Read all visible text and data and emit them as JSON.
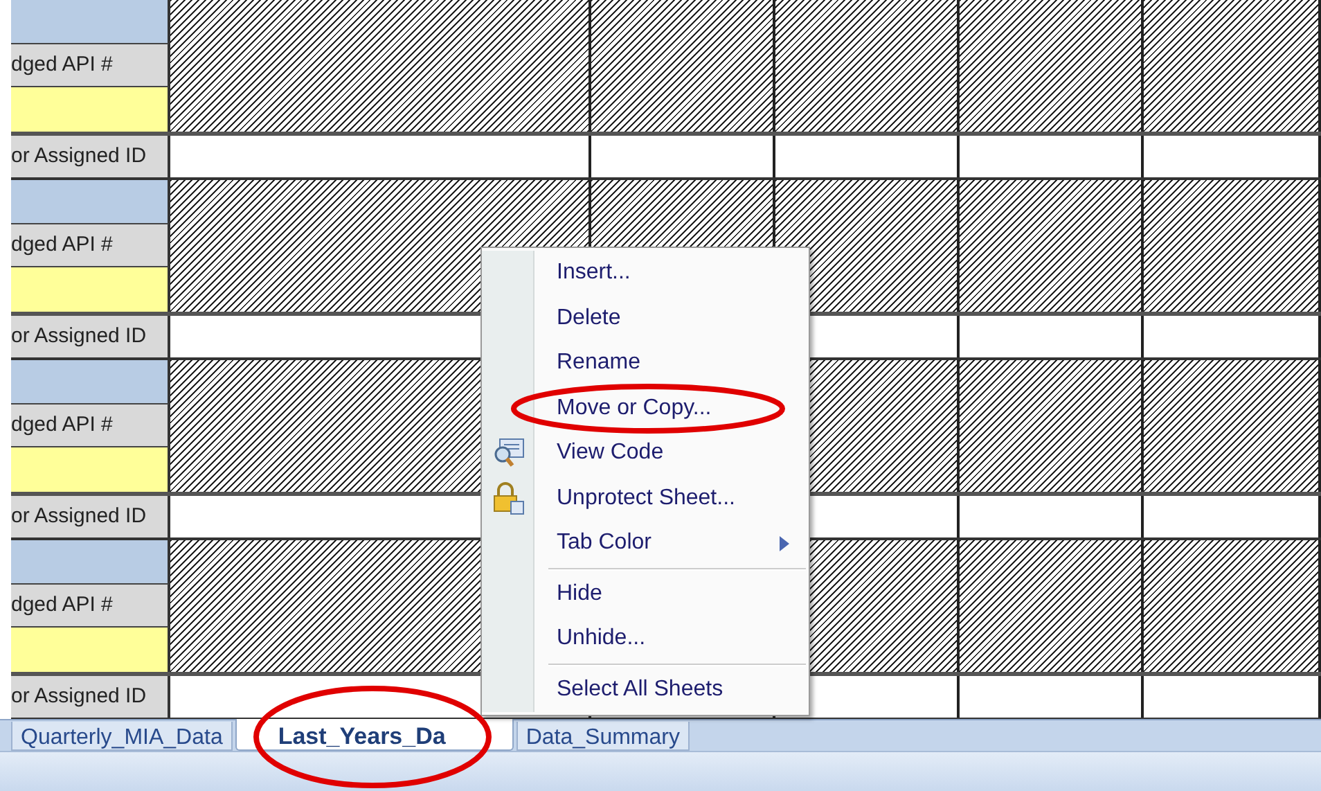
{
  "sheet": {
    "blocks": [
      {
        "api_label": "dged API #",
        "id_label": "or Assigned ID"
      },
      {
        "api_label": "dged API #",
        "id_label": "or Assigned ID"
      },
      {
        "api_label": "dged API #",
        "id_label": "or Assigned ID"
      },
      {
        "api_label": "dged API #",
        "id_label": "or Assigned ID"
      }
    ]
  },
  "sheet_tabs": [
    {
      "label": "Quarterly_MIA_Data",
      "selected": false
    },
    {
      "label": "Last_Years_Da",
      "selected": true
    },
    {
      "label": "Data_Summary",
      "selected": false
    }
  ],
  "context_menu": {
    "items": [
      {
        "kind": "item",
        "label": "Insert...",
        "highlighted": false
      },
      {
        "kind": "item",
        "label": "Delete",
        "highlighted": false
      },
      {
        "kind": "item",
        "label": "Rename",
        "highlighted": false
      },
      {
        "kind": "item",
        "label": "Move or Copy...",
        "highlighted": true
      },
      {
        "kind": "code_item",
        "label": "View Code",
        "highlighted": false
      },
      {
        "kind": "lock_item",
        "label": "Unprotect Sheet...",
        "highlighted": false
      },
      {
        "kind": "submenu",
        "label": "Tab Color",
        "highlighted": false
      },
      {
        "kind": "separator"
      },
      {
        "kind": "item",
        "label": "Hide",
        "highlighted": false
      },
      {
        "kind": "item",
        "label": "Unhide...",
        "highlighted": false
      },
      {
        "kind": "separator"
      },
      {
        "kind": "item",
        "label": "Select All Sheets",
        "highlighted": false
      }
    ]
  }
}
